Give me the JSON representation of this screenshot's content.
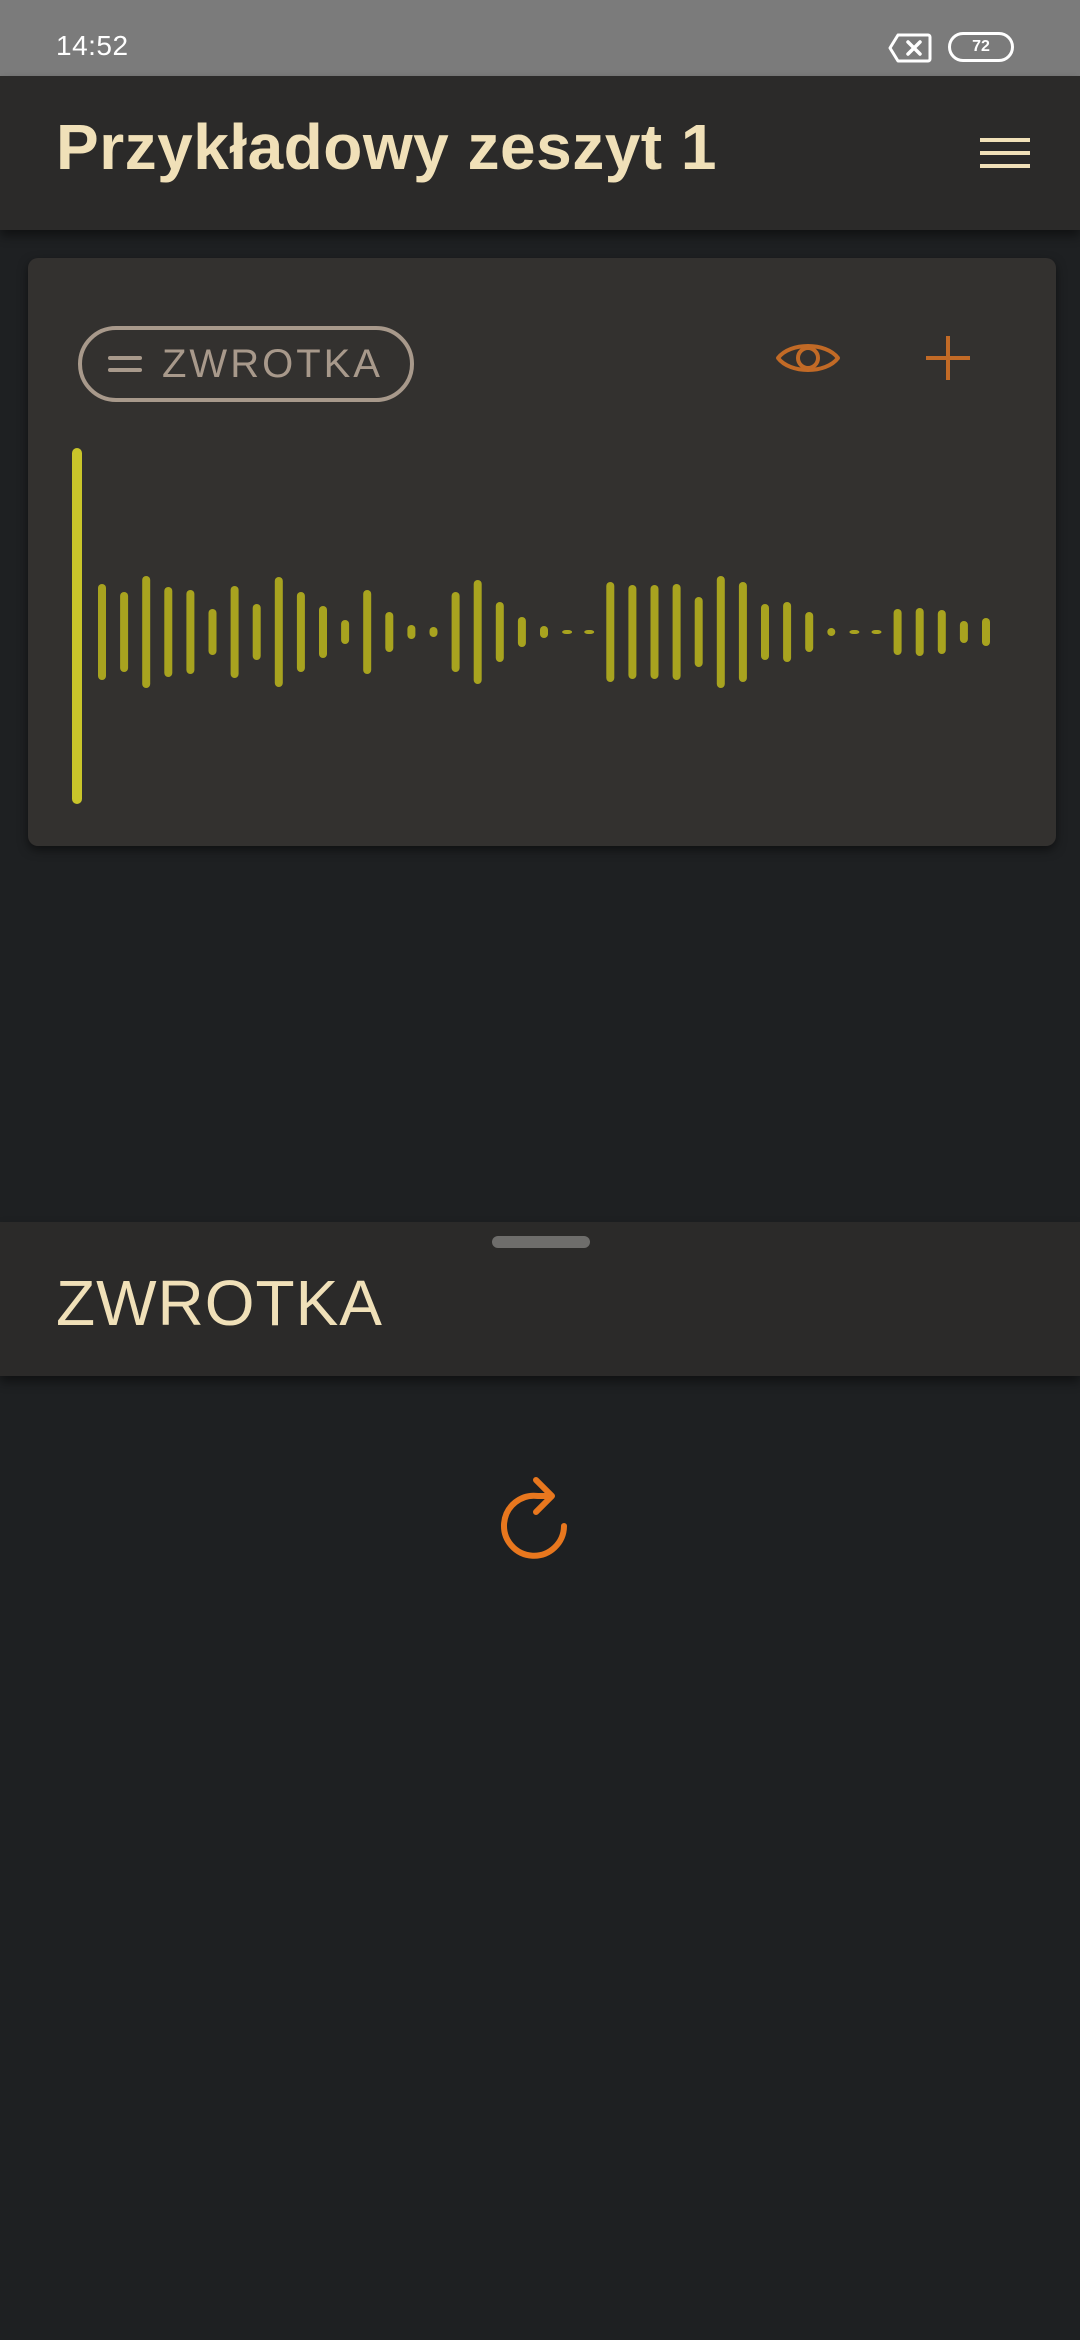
{
  "status_bar": {
    "time": "14:52",
    "battery": "72",
    "notification_icon": "close-box-icon"
  },
  "app_bar": {
    "title": "Przykładowy zeszyt 1",
    "menu_icon": "hamburger-menu-icon"
  },
  "card": {
    "section_label": "ZWROTKA",
    "eye_icon": "eye-icon",
    "plus_icon": "plus-icon",
    "waveform_color": "#a8a31f",
    "playhead_color": "#c9c52a"
  },
  "bottom_sheet": {
    "title": "ZWROTKA",
    "refresh_icon": "refresh-icon"
  },
  "colors": {
    "accent_orange": "#e8771e",
    "icon_brown": "#c26a26",
    "title_text": "#f0e0b8",
    "chip_border": "#a8998b"
  }
}
